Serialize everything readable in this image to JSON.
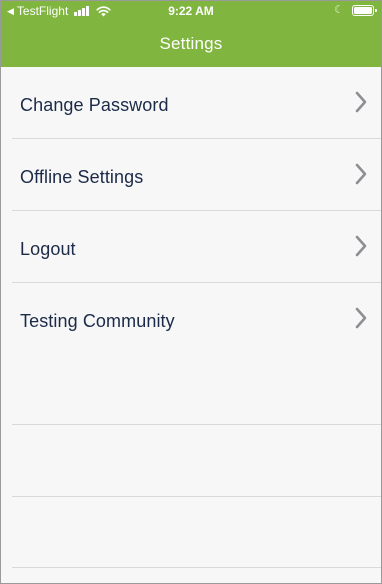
{
  "status_bar": {
    "back_app": "TestFlight",
    "time": "9:22 AM",
    "icons": [
      "back-arrow-icon",
      "cellular-signal-icon",
      "wifi-icon",
      "do-not-disturb-moon-icon",
      "battery-icon"
    ]
  },
  "header": {
    "title": "Settings",
    "background_color": "#80b540"
  },
  "settings": {
    "items": [
      {
        "label": "Change Password",
        "icon": "chevron-right-icon"
      },
      {
        "label": "Offline Settings",
        "icon": "chevron-right-icon"
      },
      {
        "label": "Logout",
        "icon": "chevron-right-icon"
      },
      {
        "label": "Testing Community",
        "icon": "chevron-right-icon"
      }
    ]
  },
  "colors": {
    "accent": "#80b540",
    "text": "#1b2a48",
    "chevron": "#8e8e93",
    "separator": "#d9d9d9",
    "background": "#f7f7f7"
  }
}
